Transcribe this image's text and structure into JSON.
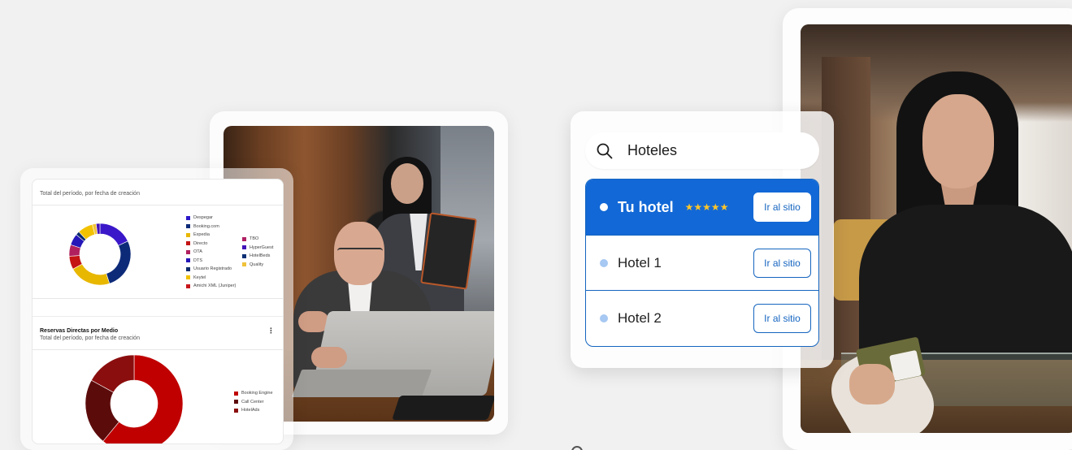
{
  "dashboard": {
    "chart1_subtitle": "Total del período, por fecha de creación",
    "chart2_title": "Reservas Directas por Medio",
    "chart2_subtitle": "Total del período, por fecha de creación",
    "menu_icon": "kebab-menu-icon",
    "legend1_col1": [
      {
        "label": "Despegar",
        "color": "#2c18c9"
      },
      {
        "label": "Booking.com",
        "color": "#0d2a78"
      },
      {
        "label": "Expedia",
        "color": "#e8b700"
      },
      {
        "label": "Directo",
        "color": "#c41414"
      },
      {
        "label": "OTA",
        "color": "#b0205f"
      },
      {
        "label": "DTS",
        "color": "#2416b8"
      },
      {
        "label": "Usuario Registrado",
        "color": "#0b2a6c"
      },
      {
        "label": "Keytel",
        "color": "#f2c200"
      },
      {
        "label": "Amichi XML (Juniper)",
        "color": "#c8171c"
      }
    ],
    "legend1_col2": [
      {
        "label": "TBO",
        "color": "#b02063"
      },
      {
        "label": "HyperGuest",
        "color": "#4313b8"
      },
      {
        "label": "HotelBeds",
        "color": "#0b2f74"
      },
      {
        "label": "Quality",
        "color": "#f0c23a"
      }
    ],
    "legend2": [
      {
        "label": "Booking Engine",
        "color": "#c00000"
      },
      {
        "label": "Call Center",
        "color": "#5c0b0b"
      },
      {
        "label": "HotelAds",
        "color": "#8b0e0e"
      }
    ]
  },
  "chart_data": [
    {
      "type": "pie",
      "variant": "donut",
      "title": "",
      "subtitle": "Total del período, por fecha de creación",
      "slices": [
        {
          "label": "Despegar",
          "value": 18,
          "color": "#3a18c9"
        },
        {
          "label": "Booking.com",
          "value": 27,
          "color": "#0d2a78"
        },
        {
          "label": "Expedia",
          "value": 22,
          "color": "#e8b700"
        },
        {
          "label": "Directo",
          "value": 7,
          "color": "#c41414"
        },
        {
          "label": "OTA",
          "value": 6,
          "color": "#b0205f"
        },
        {
          "label": "DTS",
          "value": 6,
          "color": "#2416b8"
        },
        {
          "label": "Usuario Registrado",
          "value": 2,
          "color": "#0b2a6c"
        },
        {
          "label": "Keytel",
          "value": 8,
          "color": "#f2c200"
        },
        {
          "label": "Quality",
          "value": 2,
          "color": "#f0c23a"
        },
        {
          "label": "HyperGuest",
          "value": 2,
          "color": "#4313b8"
        }
      ]
    },
    {
      "type": "pie",
      "variant": "donut",
      "title": "Reservas Directas por Medio",
      "subtitle": "Total del período, por fecha de creación",
      "slices": [
        {
          "label": "Booking Engine",
          "value": 61,
          "color": "#c00000"
        },
        {
          "label": "Call Center",
          "value": 22,
          "color": "#5c0b0b"
        },
        {
          "label": "HotelAds",
          "value": 17,
          "color": "#8b0e0e"
        }
      ]
    }
  ],
  "search": {
    "icon": "search-icon",
    "query": "Hoteles",
    "results": [
      {
        "name": "Tu hotel",
        "stars": "★★★★★",
        "button": "Ir al sitio",
        "active": true
      },
      {
        "name": "Hotel 1",
        "stars": "",
        "button": "Ir al sitio",
        "active": false
      },
      {
        "name": "Hotel 2",
        "stars": "",
        "button": "Ir al sitio",
        "active": false
      }
    ]
  }
}
